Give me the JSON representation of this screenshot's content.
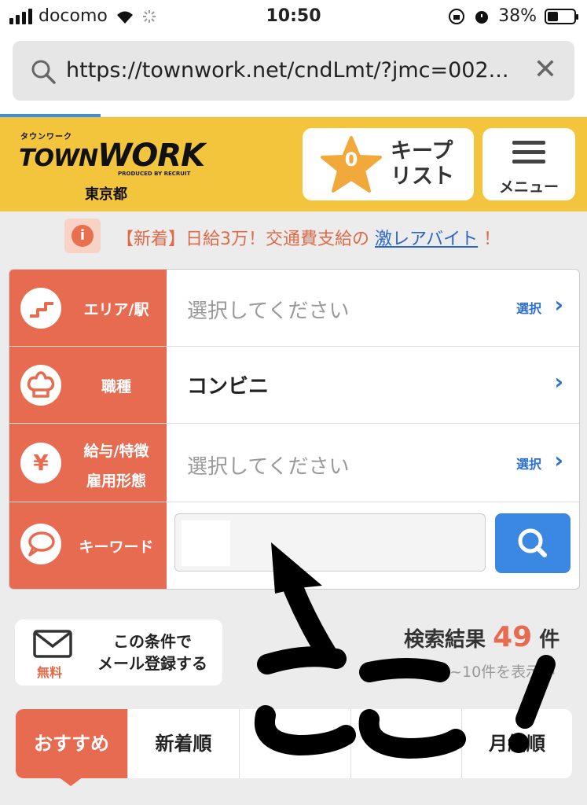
{
  "status_bar": {
    "carrier": "docomo",
    "time": "10:50",
    "battery": "38%"
  },
  "browser": {
    "url": "https://townwork.net/cndLmt/?jmc=002..."
  },
  "header": {
    "logo_kana": "タウンワーク",
    "logo_town": "TOWN",
    "logo_work": "WORK",
    "produced_by": "PRODUCED BY RECRUIT",
    "region": "東京都",
    "keep_count": "0",
    "keep_label_1": "キープ",
    "keep_label_2": "リスト",
    "menu_label": "メニュー"
  },
  "notice": {
    "prefix": "【新着】日給3万！交通費支給の ",
    "link": "激レアバイト",
    "suffix": " ！"
  },
  "search": {
    "area": {
      "label": "エリア/駅",
      "value": "選択してください",
      "select": "選択"
    },
    "job": {
      "label": "職種",
      "value": "コンビニ"
    },
    "salary": {
      "label_1": "給与/特徴",
      "label_2": "雇用形態",
      "value": "選択してください",
      "select": "選択"
    },
    "keyword": {
      "label": "キーワード"
    }
  },
  "mail": {
    "free": "無料",
    "label_1": "この条件で",
    "label_2": "メール登録する"
  },
  "results": {
    "label": "検索結果",
    "count": "49",
    "unit": "件",
    "sub": "1~10件を表示中"
  },
  "sort_tabs": [
    "おすすめ",
    "新着順",
    "",
    "",
    "月給順"
  ],
  "colors": {
    "brand_yellow": "#f2c53c",
    "accent_red": "#e76b50",
    "link_blue": "#2b6fd1"
  }
}
